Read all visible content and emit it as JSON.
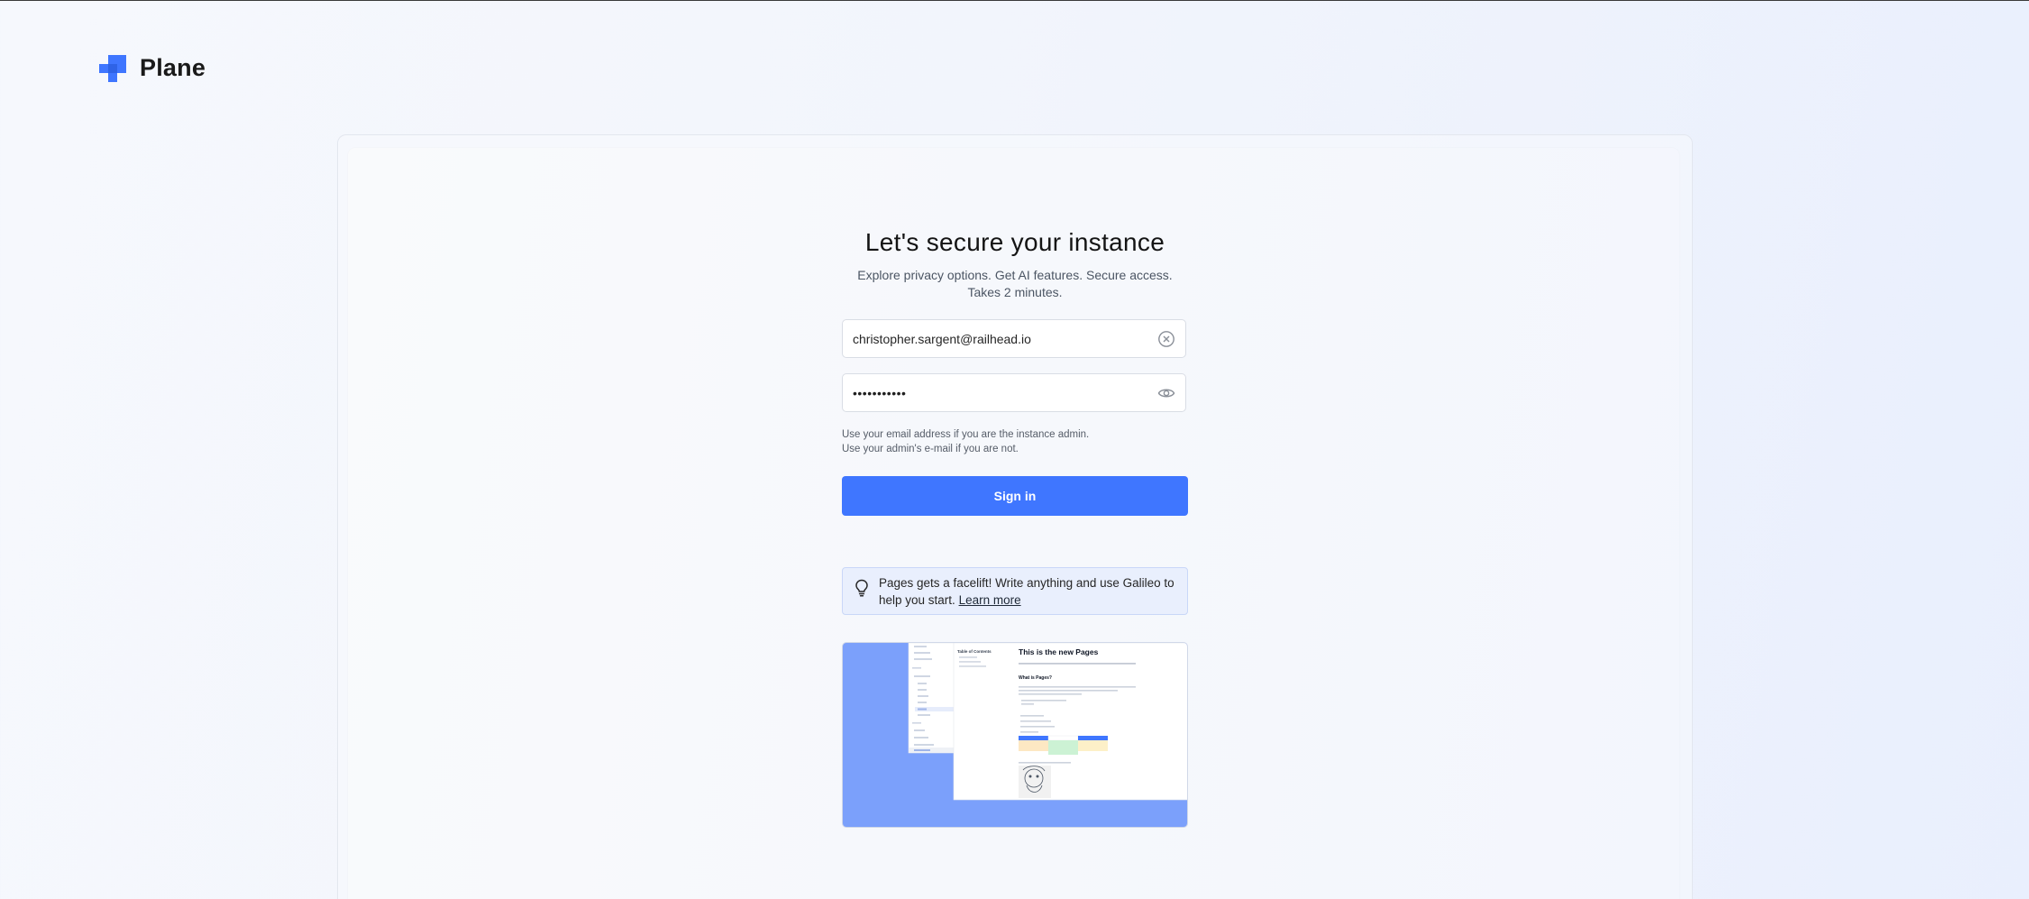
{
  "app": {
    "name": "Plane"
  },
  "auth": {
    "title": "Let's secure your instance",
    "subtitle_line1": "Explore privacy options. Get AI features. Secure access.",
    "subtitle_line2": "Takes 2 minutes.",
    "email_value": "christopher.sargent@railhead.io",
    "password_masked": "•••••••••••",
    "helper_line1": "Use your email address if you are the instance admin.",
    "helper_line2": "Use your admin's e-mail if you are not.",
    "signin_label": "Sign in"
  },
  "notice": {
    "text": "Pages gets a facelift! Write anything and use Galileo to help you start.",
    "link_label": "Learn more"
  },
  "preview": {
    "page_title": "This is the new Pages",
    "toc_label": "Table of Contents",
    "section_heading": "What is Pages?"
  },
  "colors": {
    "primary": "#3f76ff",
    "preview_bg": "#7ba0fb",
    "notice_bg": "#e9effd"
  },
  "icons": {
    "logo": "plane-logo",
    "email_clear": "circle-x-icon",
    "password_toggle": "eye-icon",
    "notice": "lightbulb-icon"
  }
}
